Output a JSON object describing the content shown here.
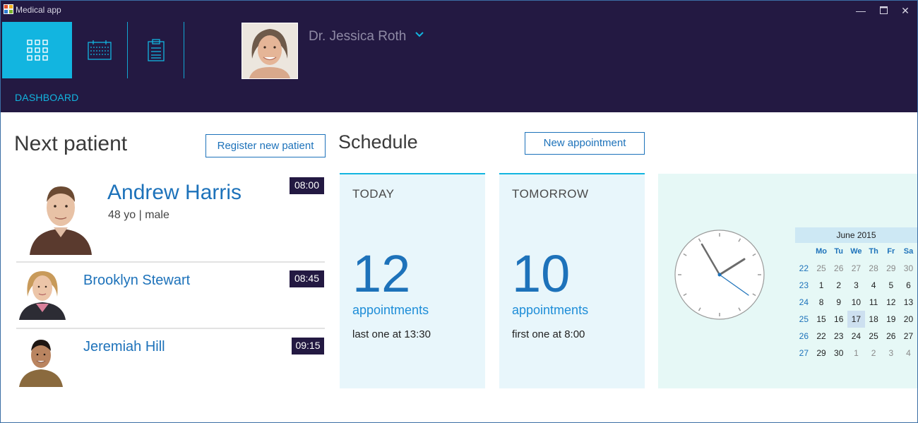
{
  "window": {
    "title": "Medical app"
  },
  "user": {
    "name": "Dr. Jessica Roth"
  },
  "nav": {
    "section": "DASHBOARD",
    "tiles": [
      "dashboard-icon",
      "calendar-icon",
      "clipboard-icon"
    ]
  },
  "next_patient": {
    "heading": "Next patient",
    "register_label": "Register new patient",
    "patients": [
      {
        "name": "Andrew Harris",
        "details": "48 yo | male",
        "time": "08:00"
      },
      {
        "name": "Brooklyn Stewart",
        "time": "08:45"
      },
      {
        "name": "Jeremiah Hill",
        "time": "09:15"
      }
    ]
  },
  "schedule": {
    "heading": "Schedule",
    "new_label": "New appointment",
    "today": {
      "title": "TODAY",
      "count": "12",
      "unit": "appointments",
      "note": "last one at 13:30"
    },
    "tomorrow": {
      "title": "TOMORROW",
      "count": "10",
      "unit": "appointments",
      "note": "first one at 8:00"
    }
  },
  "calendar": {
    "month": "June 2015",
    "days": [
      "Mo",
      "Tu",
      "We",
      "Th",
      "Fr",
      "Sa"
    ],
    "weeks": [
      {
        "wk": "22",
        "d": [
          "25",
          "26",
          "27",
          "28",
          "29",
          "30"
        ]
      },
      {
        "wk": "23",
        "d": [
          "1",
          "2",
          "3",
          "4",
          "5",
          "6"
        ]
      },
      {
        "wk": "24",
        "d": [
          "8",
          "9",
          "10",
          "11",
          "12",
          "13"
        ]
      },
      {
        "wk": "25",
        "d": [
          "15",
          "16",
          "17",
          "18",
          "19",
          "20"
        ]
      },
      {
        "wk": "26",
        "d": [
          "22",
          "23",
          "24",
          "25",
          "26",
          "27"
        ]
      },
      {
        "wk": "27",
        "d": [
          "29",
          "30",
          "1",
          "2",
          "3",
          "4"
        ]
      }
    ],
    "selected": "17"
  },
  "colors": {
    "header": "#231942",
    "accent": "#12b5e0",
    "link": "#1d72ba",
    "card": "#e8f6fb"
  }
}
